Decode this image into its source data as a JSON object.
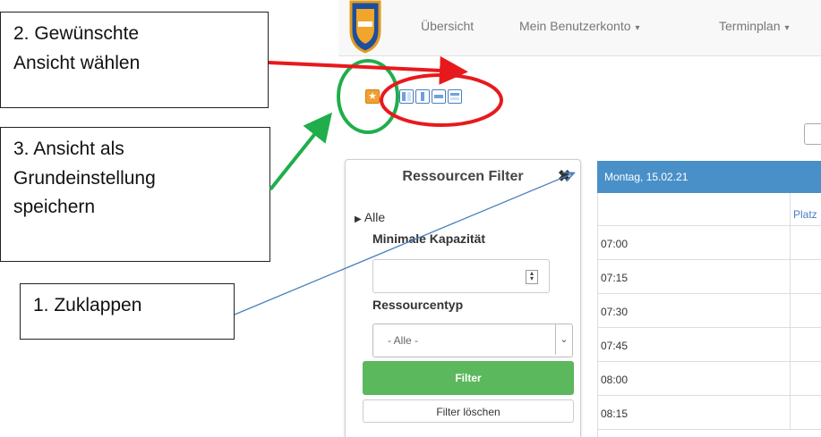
{
  "nav": {
    "items": [
      {
        "label": "Übersicht",
        "caret": ""
      },
      {
        "label": "Mein Benutzerkonto",
        "caret": "▾"
      },
      {
        "label": "Terminplan",
        "caret": "▾"
      }
    ]
  },
  "view_icons": [
    "star-icon",
    "view-icon-1",
    "view-icon-2",
    "view-icon-3",
    "view-icon-4"
  ],
  "filter": {
    "title": "Ressourcen Filter",
    "close_glyph": "✖",
    "all_label": "Alle",
    "min_capacity_label": "Minimale Kapazität",
    "resource_type_label": "Ressourcentyp",
    "resource_type_value": "- Alle -",
    "filter_button": "Filter",
    "clear_button": "Filter löschen"
  },
  "calendar": {
    "date": "Montag, 15.02.21",
    "column_fragment": "Platz",
    "times": [
      "07:00",
      "07:15",
      "07:30",
      "07:45",
      "08:00",
      "08:15"
    ]
  },
  "annotations": {
    "step2": [
      "2. Gewünschte",
      "Ansicht wählen"
    ],
    "step3": [
      "3. Ansicht als",
      "Grundeinstellung",
      "speichern"
    ],
    "step1": "1. Zuklappen"
  },
  "colors": {
    "arrow_red": "#e8191c",
    "arrow_green": "#1fae4b",
    "arrow_blue": "#4a7fc0",
    "filter_green": "#5cb85c",
    "calendar_blue": "#4a90c8"
  }
}
